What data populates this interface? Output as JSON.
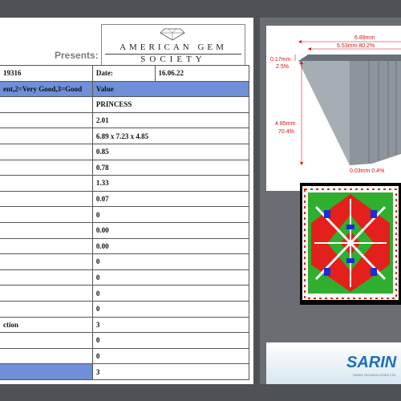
{
  "header": {
    "presents": "Presents:",
    "ags_line1": "AMERICAN GEM",
    "ags_line2": "SOCIETY"
  },
  "table": {
    "report_no": "19316",
    "date_label": "Date:",
    "date_value": "16.06.22",
    "grade_legend": "ent,2=Very Good,3=Good",
    "value_header": "Value",
    "rows": [
      {
        "label": "",
        "value": "PRINCESS"
      },
      {
        "label": "",
        "value": "2.01"
      },
      {
        "label": "",
        "value": "6.89 x 7.23 x 4.85"
      },
      {
        "label": "",
        "value": "0.85"
      },
      {
        "label": "",
        "value": "0.78"
      },
      {
        "label": "",
        "value": "1.33"
      },
      {
        "label": "",
        "value": "0.07"
      },
      {
        "label": "",
        "value": "0"
      },
      {
        "label": "",
        "value": "0.00"
      },
      {
        "label": "",
        "value": "0.00"
      },
      {
        "label": "",
        "value": "0"
      },
      {
        "label": "",
        "value": "0"
      },
      {
        "label": "",
        "value": "0"
      },
      {
        "label": "",
        "value": "0"
      },
      {
        "label": "ction",
        "value": "3"
      },
      {
        "label": "",
        "value": "0"
      },
      {
        "label": "",
        "value": "0"
      },
      {
        "label": "",
        "value": "3"
      }
    ]
  },
  "diagram": {
    "width_total": "6.89mm",
    "table_width": "5.53mm 80.2%",
    "crown_mm": "0.17mm",
    "crown_pct": "2.5%",
    "depth_mm": "4.85mm",
    "depth_pct": "70.4%",
    "culet": "0.03mm 0.4%"
  },
  "logo": {
    "name": "SARIN",
    "tagline": "SARIN TECHNOLOGIES LTD"
  },
  "colors": {
    "accent_blue": "#6f8fd8",
    "dimension_red": "#d21414",
    "sarin_blue": "#1e6fb8"
  }
}
